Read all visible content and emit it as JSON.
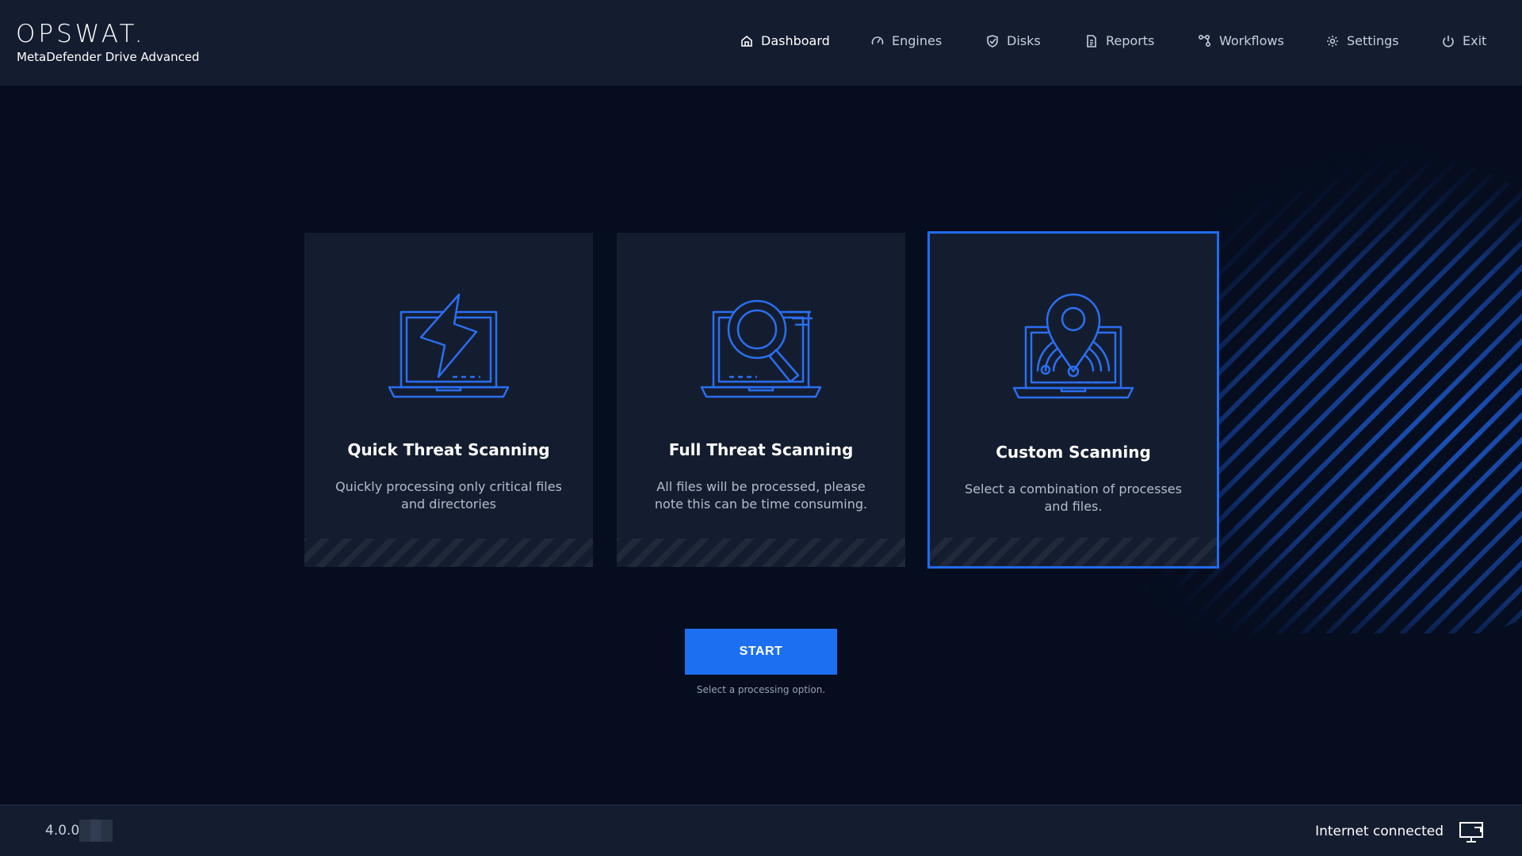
{
  "brand": {
    "logo_text": "OPSWAT.",
    "product_name": "MetaDefender Drive Advanced"
  },
  "nav": {
    "items": [
      {
        "label": "Dashboard",
        "icon": "home-icon",
        "active": true
      },
      {
        "label": "Engines",
        "icon": "gauge-icon",
        "active": false
      },
      {
        "label": "Disks",
        "icon": "shield-check-icon",
        "active": false
      },
      {
        "label": "Reports",
        "icon": "document-icon",
        "active": false
      },
      {
        "label": "Workflows",
        "icon": "workflow-icon",
        "active": false
      },
      {
        "label": "Settings",
        "icon": "gear-icon",
        "active": false
      },
      {
        "label": "Exit",
        "icon": "power-icon",
        "active": false
      }
    ]
  },
  "cards": [
    {
      "title": "Quick Threat Scanning",
      "description": "Quickly processing only critical files and directories",
      "icon": "laptop-lightning-icon",
      "selected": false
    },
    {
      "title": "Full Threat Scanning",
      "description": "All files will be processed, please note this can be time consuming.",
      "icon": "laptop-magnifier-icon",
      "selected": false
    },
    {
      "title": "Custom Scanning",
      "description": "Select a combination of processes and files.",
      "icon": "laptop-location-pin-icon",
      "selected": true
    }
  ],
  "start": {
    "label": "START",
    "hint": "Select a processing option."
  },
  "footer": {
    "version": "4.0.0",
    "status": "Internet connected",
    "status_icon": "monitor-icon"
  },
  "colors": {
    "accent": "#1d6ff2",
    "header_bg": "#141d30",
    "page_bg": "#050d1f",
    "icon_stroke": "#2a6ff0"
  }
}
